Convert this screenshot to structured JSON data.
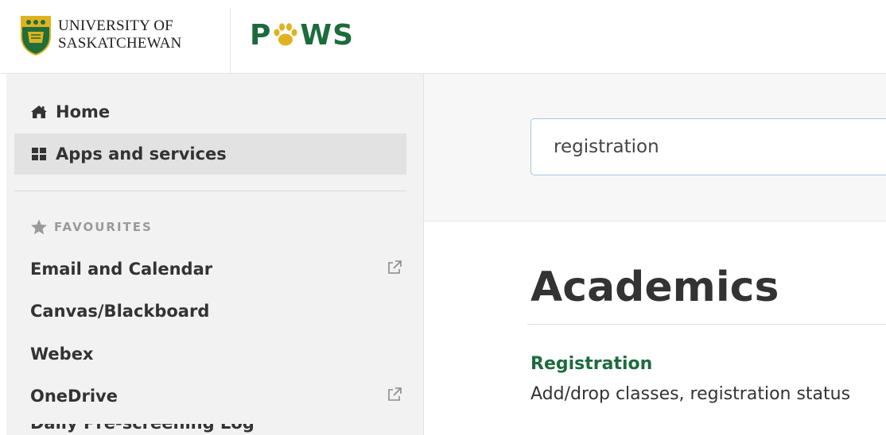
{
  "header": {
    "university_line1": "UNIVERSITY OF",
    "university_line2": "SASKATCHEWAN",
    "app_logo_letters": [
      "P",
      "WS"
    ],
    "crest_icon": "uofs-crest-icon",
    "paw_icon": "paw-print-icon",
    "colors": {
      "brand_green": "#1c6b3c",
      "crest_gold": "#e0b21f"
    }
  },
  "sidebar": {
    "nav": [
      {
        "label": "Home",
        "icon": "home-icon",
        "active": false
      },
      {
        "label": "Apps and services",
        "icon": "grid-icon",
        "active": true
      }
    ],
    "favourites_heading": "FAVOURITES",
    "favourites": [
      {
        "label": "Email and Calendar",
        "external": true
      },
      {
        "label": "Canvas/Blackboard",
        "external": false
      },
      {
        "label": "Webex",
        "external": false
      },
      {
        "label": "OneDrive",
        "external": true
      },
      {
        "label": "Daily Pre-screening Log",
        "external": false
      }
    ]
  },
  "search": {
    "value": "registration"
  },
  "results": {
    "section_title": "Academics",
    "items": [
      {
        "title": "Registration",
        "description": "Add/drop classes, registration status"
      }
    ]
  }
}
